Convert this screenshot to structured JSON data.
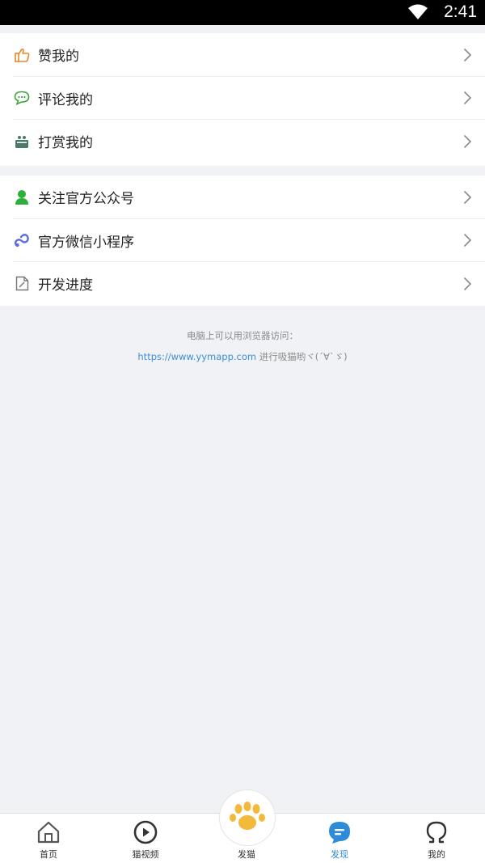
{
  "status_bar": {
    "time": "2:41"
  },
  "group1": [
    {
      "label": "赞我的",
      "icon": "thumbs-up-icon",
      "color": "#e38a2c"
    },
    {
      "label": "评论我的",
      "icon": "comment-icon",
      "color": "#3aa53a"
    },
    {
      "label": "打赏我的",
      "icon": "reward-icon",
      "color": "#4a7a6a"
    }
  ],
  "group2": [
    {
      "label": "关注官方公众号",
      "icon": "person-icon",
      "color": "#2db03a"
    },
    {
      "label": "官方微信小程序",
      "icon": "mini-program-icon",
      "color": "#5b6ee0"
    },
    {
      "label": "开发进度",
      "icon": "document-icon",
      "color": "#777777"
    }
  ],
  "footer": {
    "line1": "电脑上可以用浏览器访问：",
    "link": "https://www.yymapp.com",
    "line2_rest": " 进行吸猫哟ヾ(´∀`ゞ)"
  },
  "tabbar": {
    "home": "首页",
    "video": "猫视频",
    "post": "发猫",
    "discover": "发现",
    "mine": "我的",
    "active": "discover",
    "active_color": "#2d8bd8",
    "paw_color": "#f3b93a"
  }
}
